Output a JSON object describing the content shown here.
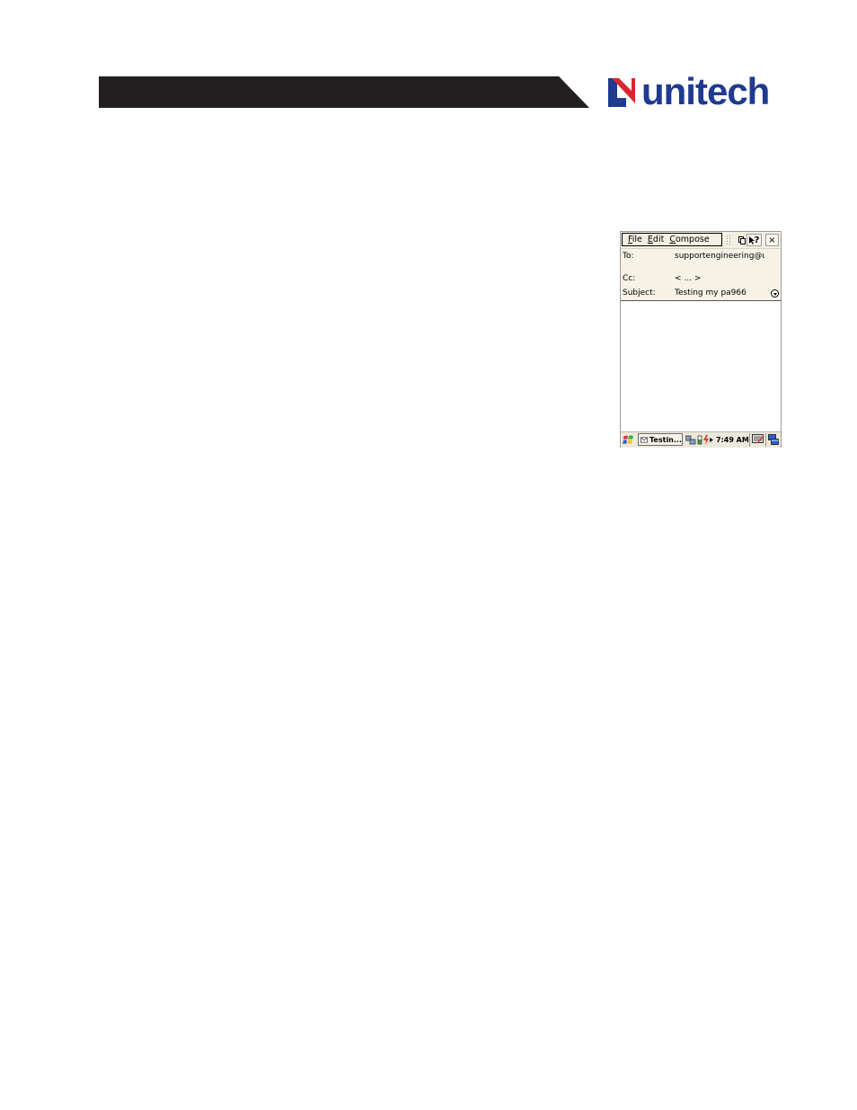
{
  "brand": {
    "logo_text": "unitech",
    "color": "#1f3a8f",
    "accent": "#d7282f"
  },
  "device_screen": {
    "menubar": {
      "items": [
        {
          "first": "F",
          "rest": "ile"
        },
        {
          "first": "E",
          "rest": "dit"
        },
        {
          "first": "C",
          "rest": "ompose"
        }
      ],
      "help_label": "?",
      "close_label": "×"
    },
    "message": {
      "to_label": "To:",
      "to_value": "supportengineering@u",
      "cc_label": "Cc:",
      "cc_value": "< ... >",
      "subject_label": "Subject:",
      "subject_value": "Testing my pa966"
    },
    "taskbar": {
      "task_label": "Testin...",
      "clock": "7:49 AM"
    }
  }
}
